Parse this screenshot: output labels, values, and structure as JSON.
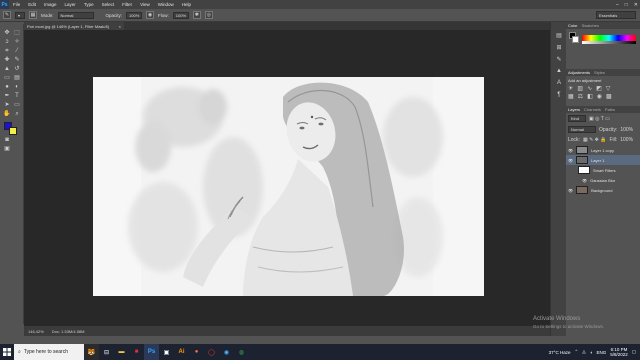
{
  "menubar": {
    "logo": "Ps",
    "items": [
      "File",
      "Edit",
      "Image",
      "Layer",
      "Type",
      "Select",
      "Filter",
      "View",
      "Window",
      "Help"
    ],
    "window_controls": [
      "–",
      "□",
      "✕"
    ]
  },
  "options_bar": {
    "mode_label": "Mode:",
    "mode_value": "Normal",
    "opacity_label": "Opacity:",
    "opacity_value": "100%",
    "flow_label": "Flow:",
    "flow_value": "100%",
    "workspace": "Essentials"
  },
  "document": {
    "tab_title": "Pori moni.jpg @ 146% (Layer 1, Filter Mask/8)",
    "tab_close": "×",
    "zoom": "146.42%",
    "doc_info": "Doc: 1.53M/4.58M"
  },
  "right_panel": {
    "color_tabs": [
      "Color",
      "Swatches"
    ],
    "adjust_tabs": [
      "Adjustments",
      "Styles"
    ],
    "adjust_title": "Add an adjustment",
    "layers_tabs": [
      "Layers",
      "Channels",
      "Paths"
    ],
    "kind_label": "Kind",
    "blend_mode": "Normal",
    "opacity_label": "Opacity:",
    "opacity_value": "100%",
    "lock_label": "Lock:",
    "fill_label": "Fill:",
    "fill_value": "100%",
    "layers": [
      {
        "name": "Layer 1 copy",
        "color": "#8a8a8a"
      },
      {
        "name": "Layer 1",
        "color": "#6b6b6b"
      },
      {
        "name": "Smart Filters",
        "color": "#ffffff"
      },
      {
        "name": "Gaussian Blur",
        "color": "#535353"
      },
      {
        "name": "Background",
        "color": "#7a6a60"
      }
    ]
  },
  "watermark": {
    "title": "Activate Windows",
    "subtitle": "Go to Settings to activate Windows."
  },
  "taskbar": {
    "search_placeholder": "Type here to search",
    "weather": "37°C Haze",
    "time": "6:10 PM",
    "date": "5/8/2022",
    "lang": "ENG"
  },
  "colors": {
    "foreground": "#1a12d8",
    "background": "#f4ee4a",
    "accent": "#31a8ff"
  }
}
